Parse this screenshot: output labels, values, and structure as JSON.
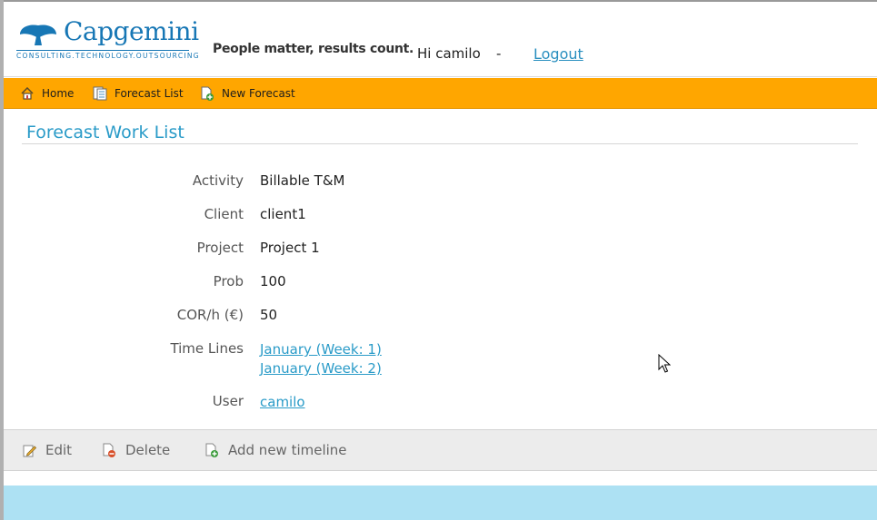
{
  "header": {
    "brand": "Capgemini",
    "brand_tagline": "CONSULTING.TECHNOLOGY.OUTSOURCING",
    "motto": "People matter, results count.",
    "greeting": "Hi camilo",
    "separator": "-",
    "logout_label": "Logout"
  },
  "nav": {
    "items": [
      {
        "label": "Home",
        "icon": "home-icon"
      },
      {
        "label": "Forecast List",
        "icon": "list-icon"
      },
      {
        "label": "New Forecast",
        "icon": "new-document-icon"
      }
    ]
  },
  "page": {
    "title": "Forecast Work List"
  },
  "details": {
    "activity": {
      "label": "Activity",
      "value": "Billable T&M"
    },
    "client": {
      "label": "Client",
      "value": "client1"
    },
    "project": {
      "label": "Project",
      "value": "Project 1"
    },
    "prob": {
      "label": "Prob",
      "value": "100"
    },
    "cor": {
      "label": "COR/h (€)",
      "value": "50"
    },
    "timelines": {
      "label": "Time Lines",
      "links": [
        "January (Week: 1)",
        "January (Week: 2)"
      ]
    },
    "user": {
      "label": "User",
      "value": "camilo"
    }
  },
  "toolbar": {
    "edit_label": "Edit",
    "delete_label": "Delete",
    "add_timeline_label": "Add new timeline"
  },
  "colors": {
    "nav_bg": "#ffa600",
    "accent": "#2a9bc8",
    "brand": "#1777b5",
    "footer_bg": "#ade1f3"
  }
}
